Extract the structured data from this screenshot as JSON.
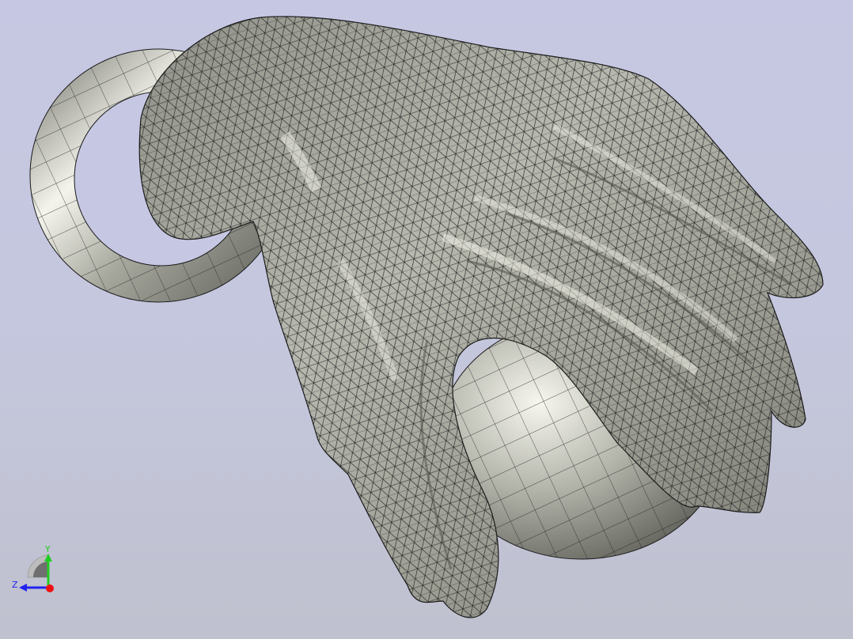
{
  "axes": {
    "y_label": "Y",
    "z_label": "Z",
    "y_color": "#22cc22",
    "z_color": "#2222ee",
    "x_color": "#ee1111"
  },
  "colors": {
    "background_top": "#c6c8e3",
    "background_bottom": "#bfc1cf",
    "mesh_fill": "#a9aa9f",
    "mesh_edge": "#1a1a1a"
  }
}
